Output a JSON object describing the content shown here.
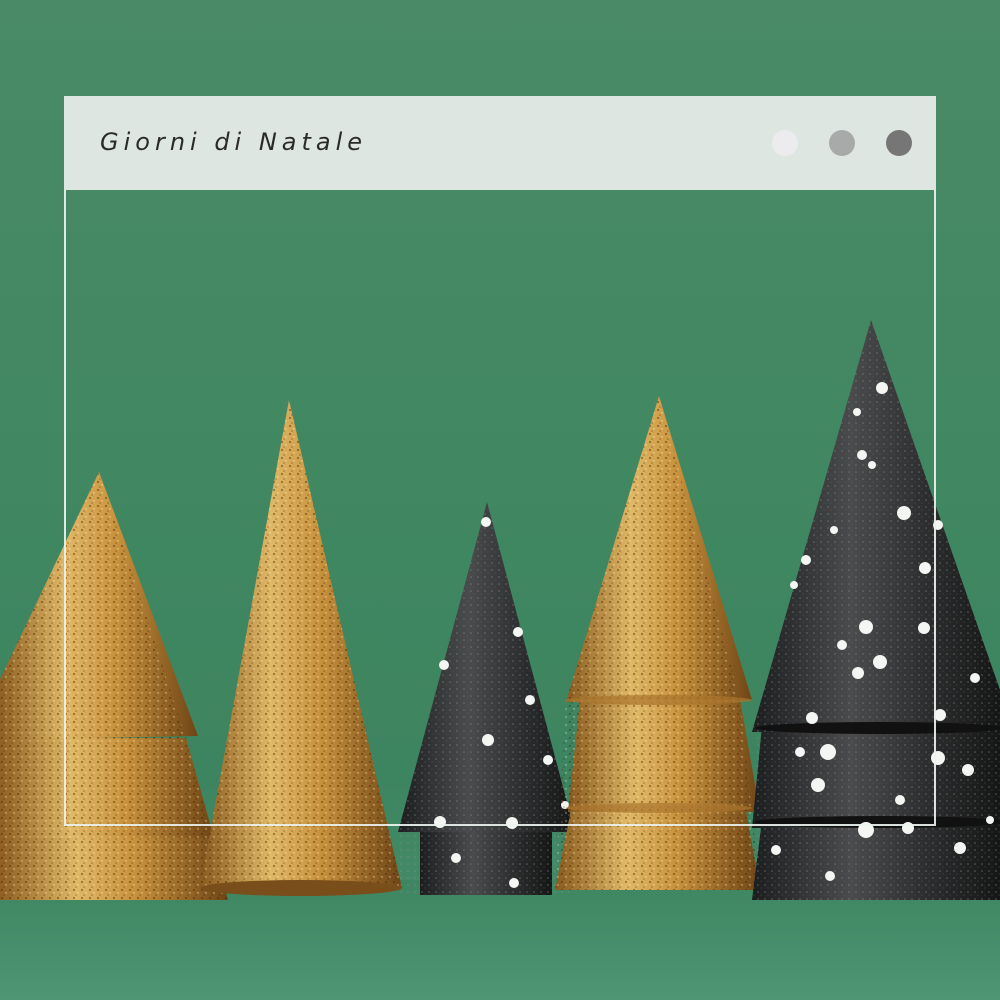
{
  "window": {
    "title": "Giorni di Natale",
    "controls": [
      {
        "name": "light-dot",
        "color": "#ececee"
      },
      {
        "name": "medium-dot",
        "color": "#a8aaa9"
      },
      {
        "name": "dark-dot",
        "color": "#767677"
      }
    ]
  },
  "scene": {
    "background_color": "#3f8761",
    "trees": [
      {
        "name": "gold-tree-tiered-left",
        "finish": "gold glitter",
        "color": "#c9953f"
      },
      {
        "name": "gold-tree-cone",
        "finish": "gold glitter",
        "color": "#c58c39"
      },
      {
        "name": "black-tree-small",
        "finish": "black glitter with white dots",
        "color": "#2a2b2c"
      },
      {
        "name": "gold-tree-tiered-middle",
        "finish": "gold glitter",
        "color": "#c99443"
      },
      {
        "name": "black-tree-large",
        "finish": "black glitter with white dots",
        "color": "#2b2c2d"
      }
    ]
  }
}
